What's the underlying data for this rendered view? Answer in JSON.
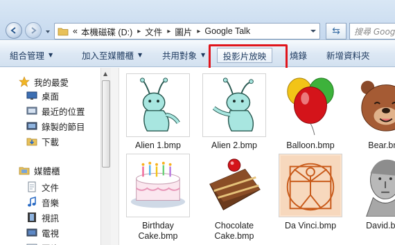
{
  "address": {
    "overflow": "«",
    "crumbs": [
      "本機磁碟 (D:)",
      "文件",
      "圖片",
      "Google Talk"
    ],
    "search_placeholder": "搜尋 Goog"
  },
  "toolbar": {
    "organize": "組合管理",
    "add_to_library": "加入至媒體櫃",
    "share": "共用對象",
    "slideshow": "投影片放映",
    "burn": "燒錄",
    "new_folder": "新增資料夾"
  },
  "sidebar": {
    "favorites": "我的最愛",
    "desktop": "桌面",
    "recent": "最近的位置",
    "recorded_tv": "錄製的節目",
    "downloads": "下載",
    "libraries": "媒體櫃",
    "documents": "文件",
    "music": "音樂",
    "videos": "視訊",
    "tv": "電視",
    "pictures": "圖片"
  },
  "files": [
    {
      "line1": "Alien 1.bmp",
      "line2": ""
    },
    {
      "line1": "Alien 2.bmp",
      "line2": ""
    },
    {
      "line1": "Balloon.bmp",
      "line2": ""
    },
    {
      "line1": "Bear.bmp",
      "line2": ""
    },
    {
      "line1": "Birthday",
      "line2": "Cake.bmp"
    },
    {
      "line1": "Chocolate",
      "line2": "Cake.bmp"
    },
    {
      "line1": "Da Vinci.bmp",
      "line2": ""
    },
    {
      "line1": "David.bmp",
      "line2": ""
    }
  ],
  "colors": {
    "highlight": "#e0141b",
    "accent": "#1e3a5f"
  }
}
